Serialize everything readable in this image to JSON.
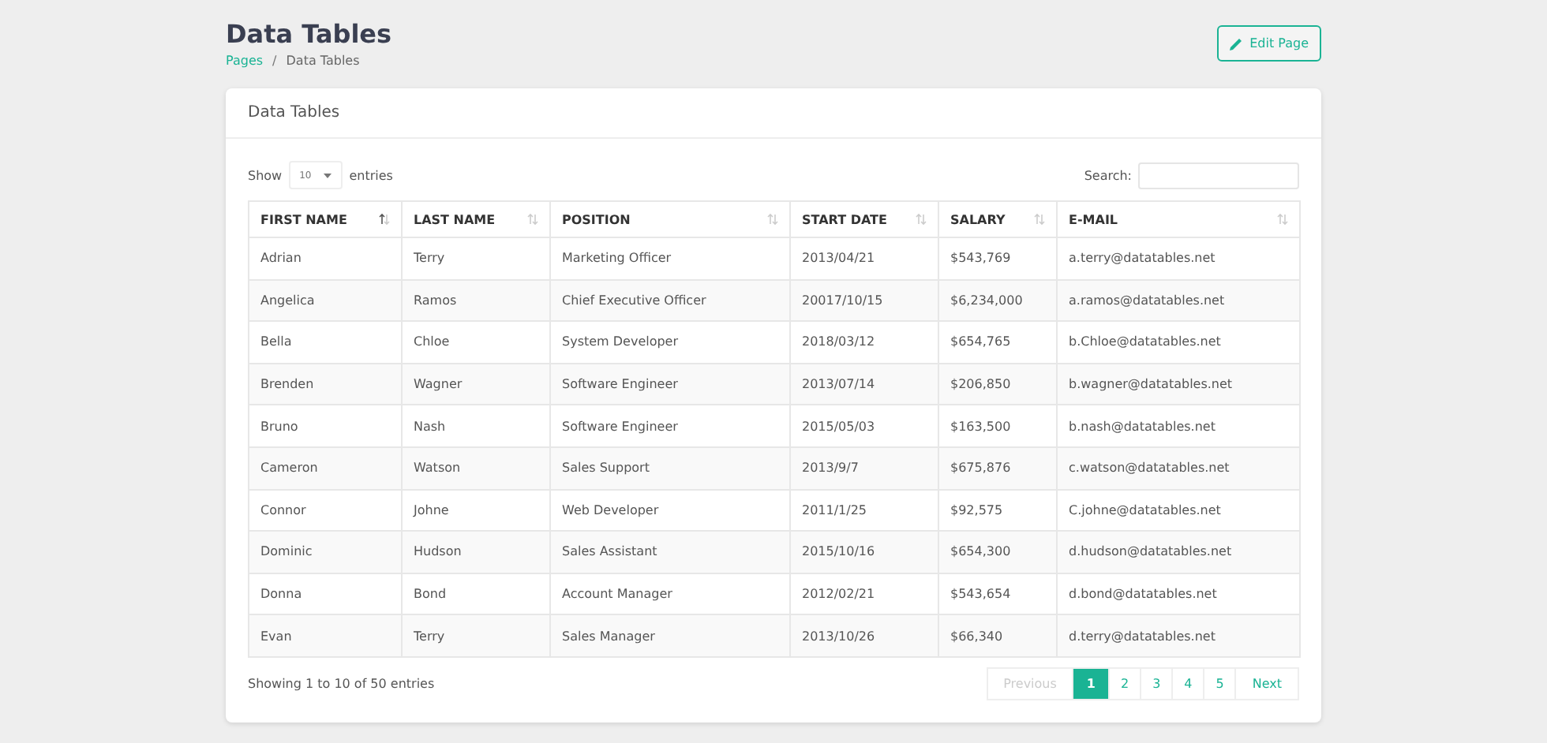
{
  "page": {
    "title": "Data Tables",
    "breadcrumb_separator": "/",
    "breadcrumb": [
      {
        "label": "Pages",
        "link": true
      },
      {
        "label": "Data Tables",
        "link": false
      }
    ],
    "edit_button": "Edit Page"
  },
  "card": {
    "title": "Data Tables",
    "length": {
      "prefix": "Show",
      "value": "10",
      "suffix": "entries"
    },
    "search": {
      "label": "Search:"
    },
    "table": {
      "columns": [
        {
          "label": "FIRST NAME",
          "selected": true
        },
        {
          "label": "LAST NAME",
          "selected": false
        },
        {
          "label": "POSITION",
          "selected": false
        },
        {
          "label": "START DATE",
          "selected": false
        },
        {
          "label": "SALARY",
          "selected": false
        },
        {
          "label": "E-MAIL",
          "selected": false
        }
      ],
      "rows": [
        [
          "Adrian",
          "Terry",
          "Marketing Officer",
          "2013/04/21",
          "$543,769",
          "a.terry@datatables.net"
        ],
        [
          "Angelica",
          "Ramos",
          "Chief Executive Officer",
          "20017/10/15",
          "$6,234,000",
          "a.ramos@datatables.net"
        ],
        [
          "Bella",
          "Chloe",
          "System Developer",
          "2018/03/12",
          "$654,765",
          "b.Chloe@datatables.net"
        ],
        [
          "Brenden",
          "Wagner",
          "Software Engineer",
          "2013/07/14",
          "$206,850",
          "b.wagner@datatables.net"
        ],
        [
          "Bruno",
          "Nash",
          "Software Engineer",
          "2015/05/03",
          "$163,500",
          "b.nash@datatables.net"
        ],
        [
          "Cameron",
          "Watson",
          "Sales Support",
          "2013/9/7",
          "$675,876",
          "c.watson@datatables.net"
        ],
        [
          "Connor",
          "Johne",
          "Web Developer",
          "2011/1/25",
          "$92,575",
          "C.johne@datatables.net"
        ],
        [
          "Dominic",
          "Hudson",
          "Sales Assistant",
          "2015/10/16",
          "$654,300",
          "d.hudson@datatables.net"
        ],
        [
          "Donna",
          "Bond",
          "Account Manager",
          "2012/02/21",
          "$543,654",
          "d.bond@datatables.net"
        ],
        [
          "Evan",
          "Terry",
          "Sales Manager",
          "2013/10/26",
          "$66,340",
          "d.terry@datatables.net"
        ]
      ]
    },
    "info": "Showing 1 to 10 of 50 entries",
    "pagination": [
      {
        "label": "Previous",
        "kind": "prev",
        "disabled": true,
        "selected": false
      },
      {
        "label": "1",
        "kind": "page",
        "disabled": false,
        "selected": true
      },
      {
        "label": "2",
        "kind": "page",
        "disabled": false,
        "selected": false
      },
      {
        "label": "3",
        "kind": "page",
        "disabled": false,
        "selected": false
      },
      {
        "label": "4",
        "kind": "page",
        "disabled": false,
        "selected": false
      },
      {
        "label": "5",
        "kind": "page",
        "disabled": false,
        "selected": false
      },
      {
        "label": "Next",
        "kind": "next",
        "disabled": false,
        "selected": false
      }
    ]
  }
}
